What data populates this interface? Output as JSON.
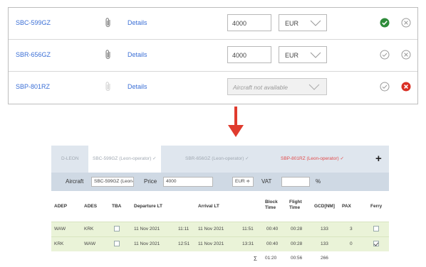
{
  "aircraft_rows": [
    {
      "registration": "SBC-599GZ",
      "details_label": "Details",
      "price_value": "4000",
      "currency": "EUR",
      "status": "selected",
      "status_color": "#2e8b3a",
      "remove_state": "inactive"
    },
    {
      "registration": "SBR-656GZ",
      "details_label": "Details",
      "price_value": "4000",
      "currency": "EUR",
      "status": "unselected",
      "remove_state": "inactive"
    },
    {
      "registration": "SBP-801RZ",
      "details_label": "Details",
      "unavailable_text": "Aircraft not available",
      "status": "unselected",
      "remove_state": "active",
      "remove_color": "#d93025"
    }
  ],
  "flight_panel": {
    "tabs": [
      {
        "label": "D-LEON"
      },
      {
        "label": "SBC-599GZ (Leon-operator) ✓"
      },
      {
        "label": "SBR-656GZ (Leon-operator) ✓"
      },
      {
        "label": "SBP-801RZ (Leon-operator) ✓"
      }
    ],
    "add_tab_label": "+",
    "form": {
      "aircraft_label": "Aircraft",
      "aircraft_value": "SBC-599GZ (Leon-... ≑",
      "price_label": "Price",
      "price_value": "4000",
      "currency_value": "EUR ≑",
      "vat_label": "VAT",
      "vat_value": "",
      "percent_label": "%"
    },
    "columns": [
      "ADEP",
      "ADES",
      "TBA",
      "Departure LT",
      "Arrival LT",
      "Block Time",
      "Flight Time",
      "GCD[NM]",
      "PAX",
      "Ferry"
    ],
    "legs": [
      {
        "adep": "WAW",
        "ades": "KRK",
        "tba": false,
        "dep_date": "11 Nov 2021",
        "dep_time": "11:11",
        "arr_date": "11 Nov 2021",
        "arr_time": "11:51",
        "block_time": "00:40",
        "flight_time": "00:28",
        "gcd": "133",
        "pax": "3",
        "ferry": false
      },
      {
        "adep": "KRK",
        "ades": "WAW",
        "tba": false,
        "dep_date": "11 Nov 2021",
        "dep_time": "12:51",
        "arr_date": "11 Nov 2021",
        "arr_time": "13:31",
        "block_time": "00:40",
        "flight_time": "00:28",
        "gcd": "133",
        "pax": "0",
        "ferry": true
      }
    ],
    "totals": {
      "sigma": "Σ",
      "block_time": "01:20",
      "flight_time": "00:56",
      "gcd": "266"
    }
  },
  "accent_color": "#3b6fd6",
  "arrow_color": "#e03b2e"
}
